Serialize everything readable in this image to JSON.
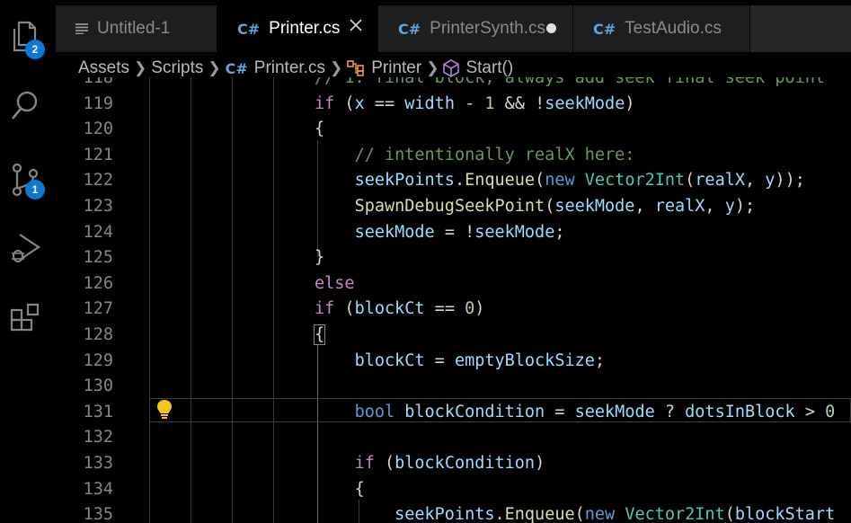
{
  "activity_bar": {
    "items": [
      {
        "icon": "files-icon",
        "badge": "2"
      },
      {
        "icon": "search-icon"
      },
      {
        "icon": "source-control-icon",
        "badge": "1"
      },
      {
        "icon": "run-debug-icon"
      },
      {
        "icon": "extensions-icon"
      }
    ]
  },
  "tabs": [
    {
      "label": "Untitled-1",
      "icon": "text-file-icon",
      "active": false
    },
    {
      "label": "Printer.cs",
      "icon": "csharp-icon",
      "active": true
    },
    {
      "label": "PrinterSynth.cs",
      "icon": "csharp-icon",
      "active": false,
      "dirty": true
    },
    {
      "label": "TestAudio.cs",
      "icon": "csharp-icon",
      "active": false
    }
  ],
  "breadcrumb": [
    "Assets",
    "Scripts",
    "Printer.cs",
    "Printer",
    "Start()"
  ],
  "csharp_glyph": "C#",
  "editor": {
    "lines": [
      {
        "n": "118",
        "code": "// 1. final block, always add seek final seek point"
      },
      {
        "n": "119",
        "code": "if (x == width - 1 && !seekMode)"
      },
      {
        "n": "120",
        "code": "{"
      },
      {
        "n": "121",
        "code": "    // intentionally realX here:"
      },
      {
        "n": "122",
        "code": "    seekPoints.Enqueue(new Vector2Int(realX, y));"
      },
      {
        "n": "123",
        "code": "    SpawnDebugSeekPoint(seekMode, realX, y);"
      },
      {
        "n": "124",
        "code": "    seekMode = !seekMode;"
      },
      {
        "n": "125",
        "code": "}"
      },
      {
        "n": "126",
        "code": "else"
      },
      {
        "n": "127",
        "code": "if (blockCt == 0)"
      },
      {
        "n": "128",
        "code": "{"
      },
      {
        "n": "129",
        "code": "    blockCt = emptyBlockSize;"
      },
      {
        "n": "130",
        "code": ""
      },
      {
        "n": "131",
        "code": "    bool blockCondition = seekMode ? dotsInBlock > 0"
      },
      {
        "n": "132",
        "code": ""
      },
      {
        "n": "133",
        "code": "    if (blockCondition)"
      },
      {
        "n": "134",
        "code": "    {"
      },
      {
        "n": "135",
        "code": "        seekPoints.Enqueue(new Vector2Int(blockStart"
      }
    ]
  }
}
